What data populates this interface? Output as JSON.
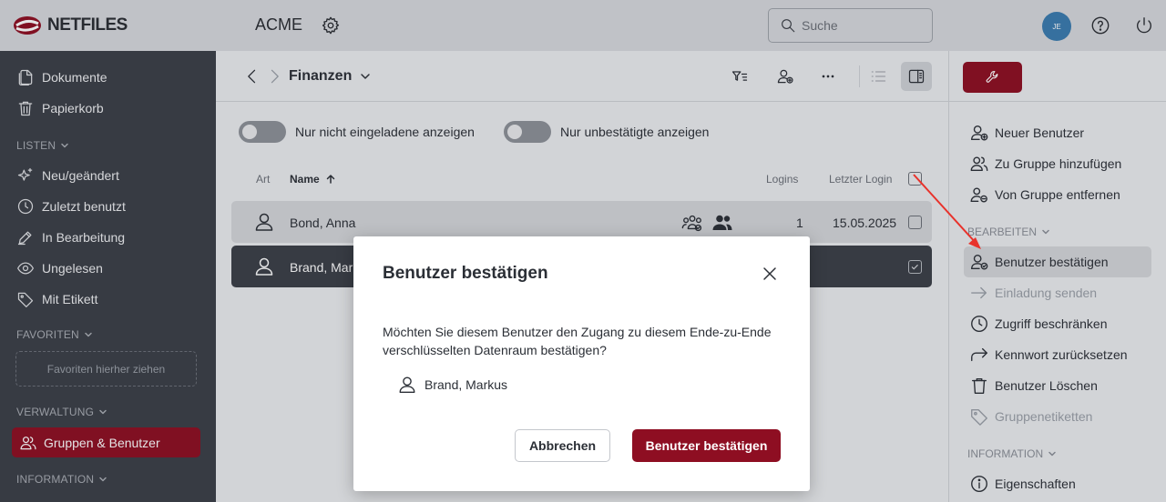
{
  "brand": {
    "name": "NETFILES",
    "accent": "#8e0e22"
  },
  "header": {
    "workspace": "ACME",
    "search_placeholder": "Suche",
    "avatar_initials": "JE"
  },
  "sidebar": {
    "items_top": [
      {
        "label": "Dokumente",
        "icon": "document-icon"
      },
      {
        "label": "Papierkorb",
        "icon": "trash-icon"
      }
    ],
    "section_lists": "LISTEN",
    "lists": [
      {
        "label": "Neu/geändert",
        "icon": "sparkle-icon"
      },
      {
        "label": "Zuletzt benutzt",
        "icon": "clock-icon"
      },
      {
        "label": "In Bearbeitung",
        "icon": "edit-icon"
      },
      {
        "label": "Ungelesen",
        "icon": "eye-icon"
      },
      {
        "label": "Mit Etikett",
        "icon": "tag-icon"
      }
    ],
    "section_favorites": "FAVORITEN",
    "favorites_drop": "Favoriten hierher ziehen",
    "section_admin": "VERWALTUNG",
    "admin_active": "Gruppen & Benutzer",
    "section_info": "INFORMATION"
  },
  "main": {
    "breadcrumb": "Finanzen",
    "toggle_uninvited": "Nur nicht eingeladene anzeigen",
    "toggle_unconfirmed": "Nur unbestätigte anzeigen",
    "columns": {
      "type": "Art",
      "name": "Name",
      "logins": "Logins",
      "last_login": "Letzter Login"
    },
    "rows": [
      {
        "name": "Bond, Anna",
        "logins": "1",
        "last_login": "15.05.2025",
        "selected": false
      },
      {
        "name": "Brand, Markus",
        "logins": "",
        "last_login": "",
        "selected": true
      }
    ]
  },
  "actions": {
    "items": [
      {
        "label": "Neuer Benutzer",
        "icon": "user-add-icon",
        "enabled": true
      },
      {
        "label": "Zu Gruppe hinzufügen",
        "icon": "group-add-icon",
        "enabled": true
      },
      {
        "label": "Von Gruppe entfernen",
        "icon": "group-remove-icon",
        "enabled": true
      }
    ],
    "section_edit": "BEARBEITEN",
    "edit_items": [
      {
        "label": "Benutzer bestätigen",
        "icon": "user-confirm-icon",
        "enabled": true,
        "highlighted": true
      },
      {
        "label": "Einladung senden",
        "icon": "arrow-right-icon",
        "enabled": false
      },
      {
        "label": "Zugriff beschränken",
        "icon": "clock-icon",
        "enabled": true
      },
      {
        "label": "Kennwort zurücksetzen",
        "icon": "redirect-arrow-icon",
        "enabled": true
      },
      {
        "label": "Benutzer Löschen",
        "icon": "trash-icon",
        "enabled": true
      },
      {
        "label": "Gruppenetiketten",
        "icon": "tag-icon",
        "enabled": false
      }
    ],
    "section_info": "INFORMATION",
    "info_items": [
      {
        "label": "Eigenschaften",
        "icon": "info-icon",
        "enabled": true
      }
    ]
  },
  "dialog": {
    "title": "Benutzer bestätigen",
    "message": "Möchten Sie diesem Benutzer den Zugang zu diesem Ende-zu-Ende verschlüsselten Datenraum bestätigen?",
    "user": "Brand, Markus",
    "cancel": "Abbrechen",
    "confirm": "Benutzer bestätigen"
  },
  "annotation_color": "#e8322b"
}
